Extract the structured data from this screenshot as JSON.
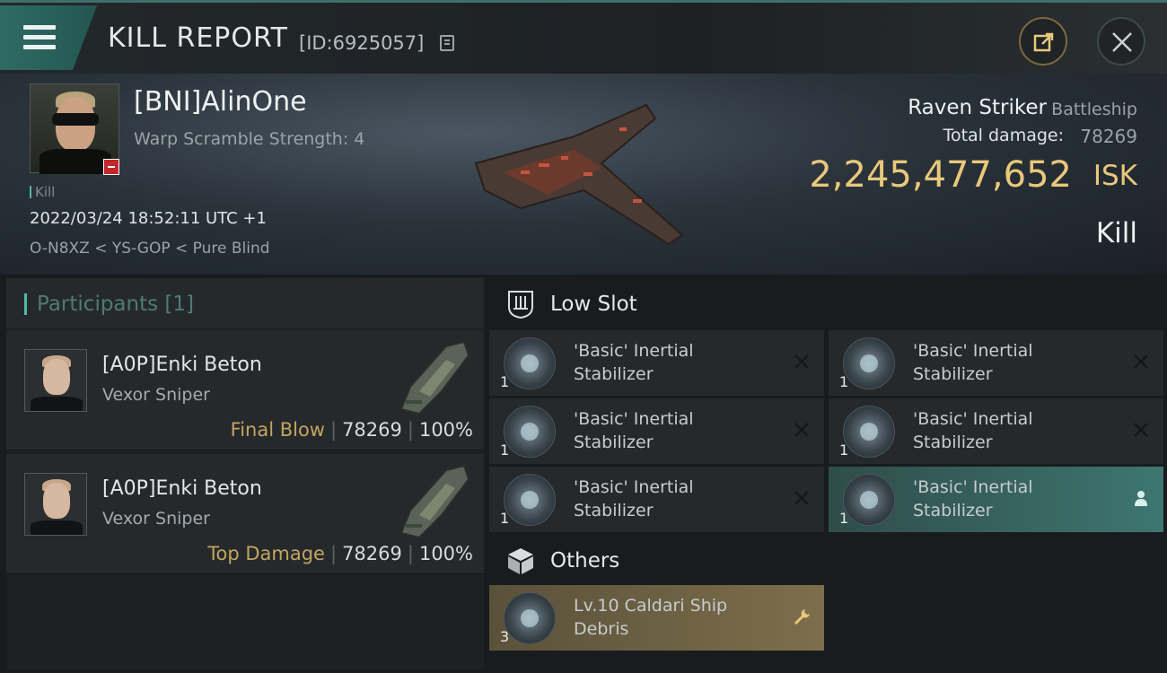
{
  "header": {
    "title": "KILL REPORT",
    "report_id": "[ID:6925057]"
  },
  "victim": {
    "name": "[BNI]AlinOne",
    "warp_scramble": "Warp Scramble Strength: 4",
    "kill_tag": "Kill",
    "timestamp": "2022/03/24 18:52:11 UTC +1",
    "location": "O-N8XZ < YS-GOP < Pure Blind",
    "ship_name": "Raven Striker",
    "ship_class": "Battleship",
    "total_damage_label": "Total damage:",
    "total_damage_value": "78269",
    "isk_value": "2,245,477,652",
    "isk_unit": "ISK",
    "result": "Kill"
  },
  "participants": {
    "title": "Participants [1]",
    "list": [
      {
        "name": "[A0P]Enki Beton",
        "ship": "Vexor Sniper",
        "role": "Final Blow",
        "damage": "78269",
        "percent": "100%"
      },
      {
        "name": "[A0P]Enki Beton",
        "ship": "Vexor Sniper",
        "role": "Top Damage",
        "damage": "78269",
        "percent": "100%"
      }
    ]
  },
  "low_slot": {
    "title": "Low Slot",
    "items": [
      {
        "name": "'Basic' Inertial Stabilizer",
        "qty": "1",
        "status": "destroyed"
      },
      {
        "name": "'Basic' Inertial Stabilizer",
        "qty": "1",
        "status": "destroyed"
      },
      {
        "name": "'Basic' Inertial Stabilizer",
        "qty": "1",
        "status": "destroyed"
      },
      {
        "name": "'Basic' Inertial Stabilizer",
        "qty": "1",
        "status": "destroyed"
      },
      {
        "name": "'Basic' Inertial Stabilizer",
        "qty": "1",
        "status": "destroyed"
      },
      {
        "name": "'Basic' Inertial Stabilizer",
        "qty": "1",
        "status": "dropped"
      }
    ]
  },
  "others": {
    "title": "Others",
    "items": [
      {
        "name": "Lv.10 Caldari Ship Debris",
        "qty": "3",
        "status": "wrench"
      }
    ]
  },
  "colors": {
    "accent_teal": "#4fb7a6",
    "isk_gold": "#e9c87b",
    "role_gold": "#c2a560"
  }
}
